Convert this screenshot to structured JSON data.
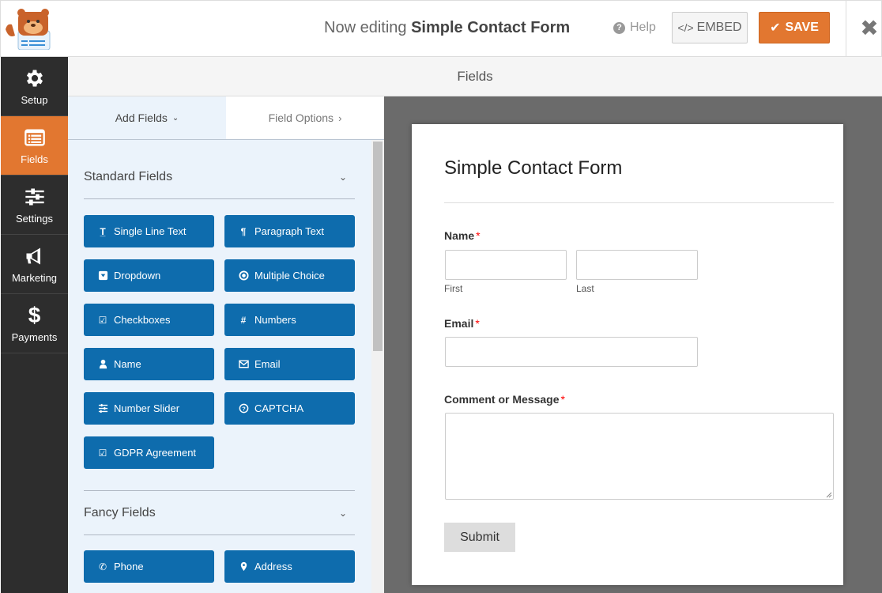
{
  "header": {
    "title_prefix": "Now editing",
    "form_name": "Simple Contact Form",
    "help_label": "Help",
    "embed_label": "EMBED",
    "save_label": "SAVE"
  },
  "sidebar": {
    "items": [
      {
        "label": "Setup",
        "icon": "gear-icon"
      },
      {
        "label": "Fields",
        "icon": "fields-list-icon",
        "active": true
      },
      {
        "label": "Settings",
        "icon": "sliders-icon"
      },
      {
        "label": "Marketing",
        "icon": "megaphone-icon"
      },
      {
        "label": "Payments",
        "icon": "dollar-icon"
      }
    ]
  },
  "section_title": "Fields",
  "panel": {
    "tabs": [
      {
        "label": "Add Fields",
        "active": true
      },
      {
        "label": "Field Options",
        "active": false
      }
    ],
    "standard_fields": {
      "title": "Standard Fields",
      "buttons": [
        {
          "label": "Single Line Text",
          "icon": "text-icon"
        },
        {
          "label": "Paragraph Text",
          "icon": "paragraph-icon"
        },
        {
          "label": "Dropdown",
          "icon": "dropdown-icon"
        },
        {
          "label": "Multiple Choice",
          "icon": "radio-icon"
        },
        {
          "label": "Checkboxes",
          "icon": "checkbox-icon"
        },
        {
          "label": "Numbers",
          "icon": "hash-icon"
        },
        {
          "label": "Name",
          "icon": "user-icon"
        },
        {
          "label": "Email",
          "icon": "envelope-icon"
        },
        {
          "label": "Number Slider",
          "icon": "sliders-icon"
        },
        {
          "label": "CAPTCHA",
          "icon": "question-icon"
        },
        {
          "label": "GDPR Agreement",
          "icon": "checkbox-icon"
        }
      ]
    },
    "fancy_fields": {
      "title": "Fancy Fields",
      "buttons": [
        {
          "label": "Phone",
          "icon": "phone-icon"
        },
        {
          "label": "Address",
          "icon": "map-marker-icon"
        }
      ]
    }
  },
  "form": {
    "title": "Simple Contact Form",
    "fields": {
      "name": {
        "label": "Name",
        "required": "*",
        "first_sublabel": "First",
        "last_sublabel": "Last",
        "first_value": "",
        "last_value": ""
      },
      "email": {
        "label": "Email",
        "required": "*",
        "value": ""
      },
      "message": {
        "label": "Comment or Message",
        "required": "*",
        "value": ""
      }
    },
    "submit_label": "Submit"
  },
  "colors": {
    "accent_orange": "#e27730",
    "field_button_blue": "#0e6cad",
    "sidebar_dark": "#2d2d2d",
    "panel_bg": "#ebf3fb"
  }
}
